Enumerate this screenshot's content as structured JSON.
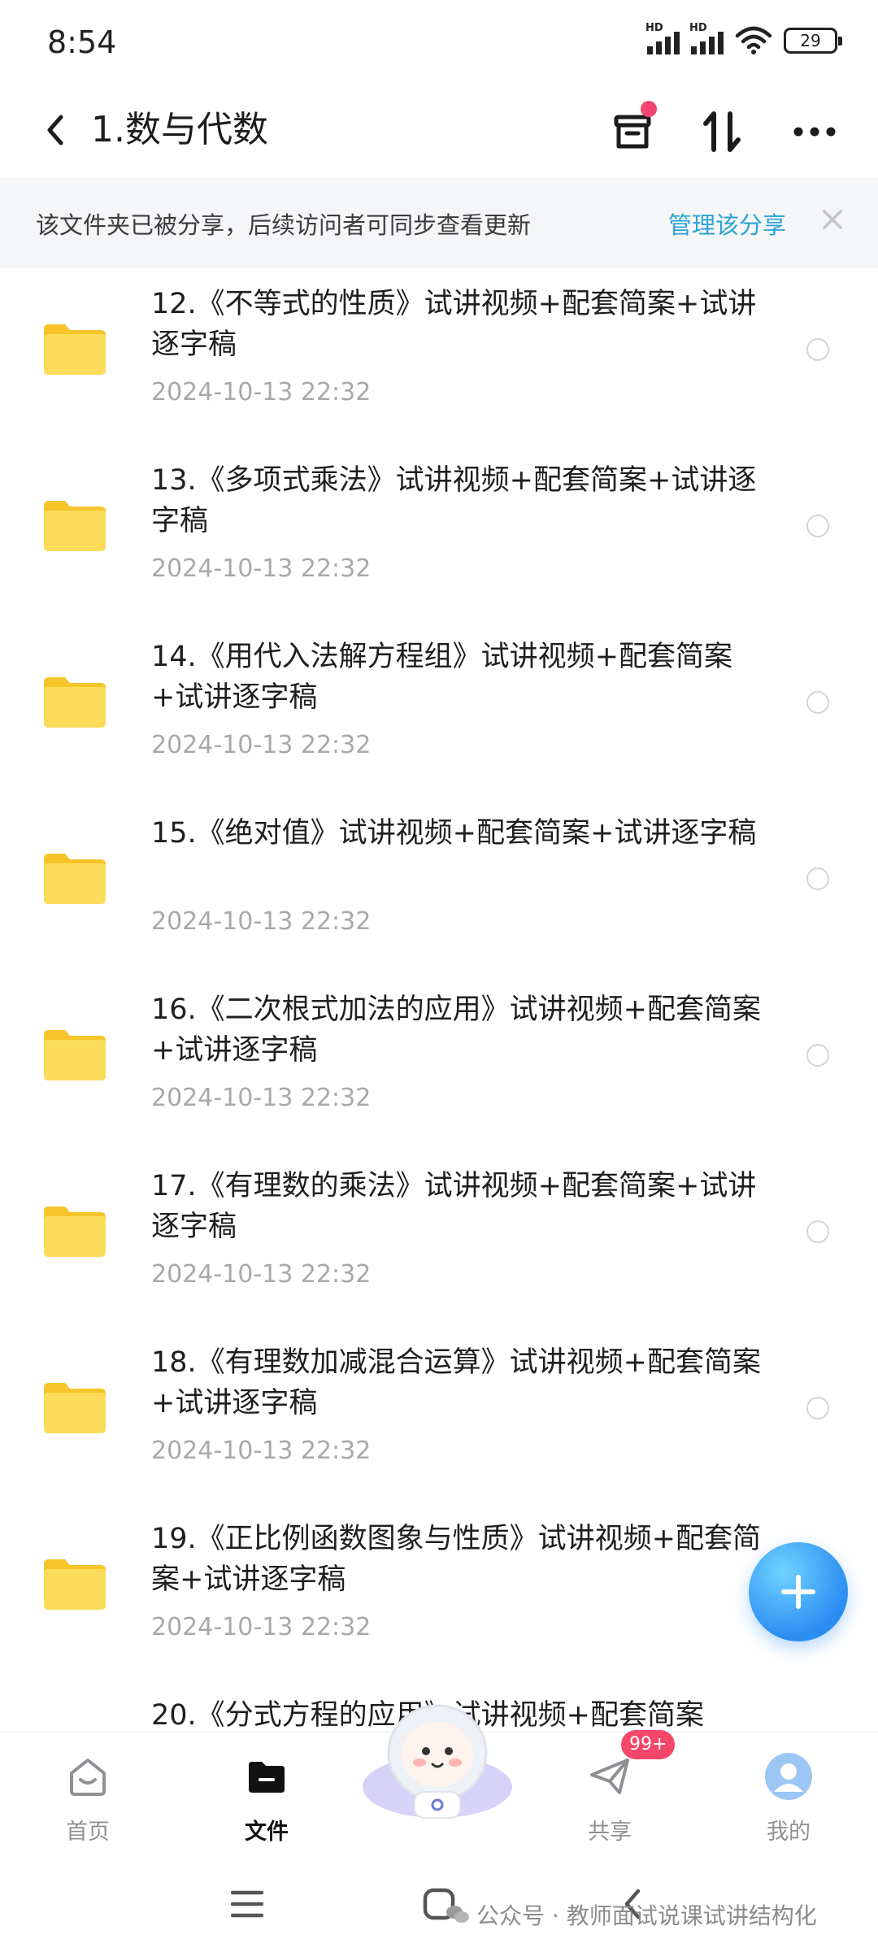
{
  "status_bar": {
    "time": "8:54",
    "hd1": "HD",
    "hd2": "HD",
    "battery": "29"
  },
  "header": {
    "title": "1.数与代数",
    "icons": [
      "back-icon",
      "trash-bin-icon",
      "sort-icon",
      "more-icon"
    ]
  },
  "share_banner": {
    "message": "该文件夹已被分享，后续访问者可同步查看更新",
    "manage": "管理该分享",
    "close_icon": "close-icon"
  },
  "files": [
    {
      "title": "12.《不等式的性质》试讲视频+配套简案+试讲逐字稿",
      "time": "2024-10-13  22:32"
    },
    {
      "title": "13.《多项式乘法》试讲视频+配套简案+试讲逐字稿",
      "time": "2024-10-13  22:32"
    },
    {
      "title": "14.《用代入法解方程组》试讲视频+配套简案+试讲逐字稿",
      "time": "2024-10-13  22:32"
    },
    {
      "title": "15.《绝对值》试讲视频+配套简案+试讲逐字稿",
      "time": "2024-10-13  22:32"
    },
    {
      "title": "16.《二次根式加法的应用》试讲视频+配套简案+试讲逐字稿",
      "time": "2024-10-13  22:32"
    },
    {
      "title": "17.《有理数的乘法》试讲视频+配套简案+试讲逐字稿",
      "time": "2024-10-13  22:32"
    },
    {
      "title": "18.《有理数加减混合运算》试讲视频+配套简案+试讲逐字稿",
      "time": "2024-10-13  22:32"
    },
    {
      "title": "19.《正比例函数图象与性质》试讲视频+配套简案+试讲逐字稿",
      "time": "2024-10-13  22:32"
    },
    {
      "title": "20.《分式方程的应用》试讲视频+配套简案",
      "time": ""
    }
  ],
  "tabs": [
    {
      "label": "首页",
      "icon": "home-icon"
    },
    {
      "label": "文件",
      "icon": "folder-icon"
    },
    {
      "label": "共享",
      "icon": "paper-plane-icon"
    },
    {
      "label": "我的",
      "icon": "avatar-icon"
    }
  ],
  "share_badge": "99+",
  "watermark": "公众号 · 教师面试说课试讲结构化",
  "colors": {
    "accent": "#2aa3d6",
    "badge": "#f4476a",
    "fab": "#2b8df2",
    "folder": "#f9cb2f"
  }
}
